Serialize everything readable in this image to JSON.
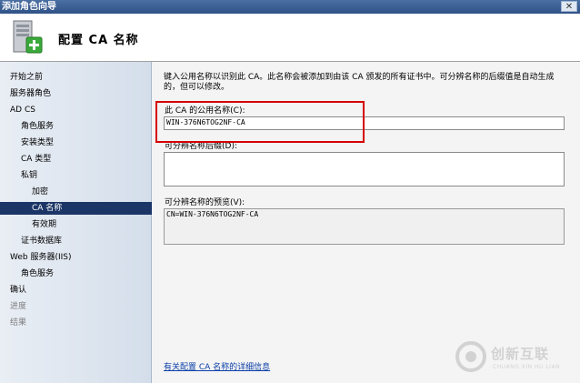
{
  "window": {
    "title": "添加角色向导",
    "close_glyph": "✕"
  },
  "header": {
    "title": "配置 CA 名称",
    "icon": "server-add-icon"
  },
  "sidebar": {
    "items": [
      {
        "label": "开始之前",
        "state": "normal"
      },
      {
        "label": "服务器角色",
        "state": "normal"
      },
      {
        "label": "AD CS",
        "state": "normal"
      },
      {
        "label": "角色服务",
        "state": "normal"
      },
      {
        "label": "安装类型",
        "state": "normal"
      },
      {
        "label": "CA 类型",
        "state": "normal"
      },
      {
        "label": "私钥",
        "state": "normal"
      },
      {
        "label": "加密",
        "state": "normal"
      },
      {
        "label": "CA 名称",
        "state": "selected"
      },
      {
        "label": "有效期",
        "state": "normal"
      },
      {
        "label": "证书数据库",
        "state": "normal"
      },
      {
        "label": "Web 服务器(IIS)",
        "state": "normal"
      },
      {
        "label": "角色服务",
        "state": "normal"
      },
      {
        "label": "确认",
        "state": "normal"
      },
      {
        "label": "进度",
        "state": "disabled"
      },
      {
        "label": "结果",
        "state": "disabled"
      }
    ]
  },
  "main": {
    "instruction": "键入公用名称以识别此 CA。此名称会被添加到由该 CA 颁发的所有证书中。可分辨名称的后缀值是自动生成的，但可以修改。",
    "common_name_label": "此 CA 的公用名称(C):",
    "common_name_value": "WIN-376N6TOG2NF-CA",
    "suffix_label": "可分辨名称后缀(D):",
    "suffix_value": "",
    "preview_label": "可分辨名称的预览(V):",
    "preview_value": "CN=WIN-376N6TOG2NF-CA",
    "help_link": "有关配置 CA 名称的详细信息"
  },
  "watermark": {
    "name": "创新互联",
    "sub": "CHUANG XIN HU LIAN"
  },
  "colors": {
    "selected_bg": "#1b3566",
    "highlight_box": "#d40000",
    "link": "#0b3fa8"
  }
}
